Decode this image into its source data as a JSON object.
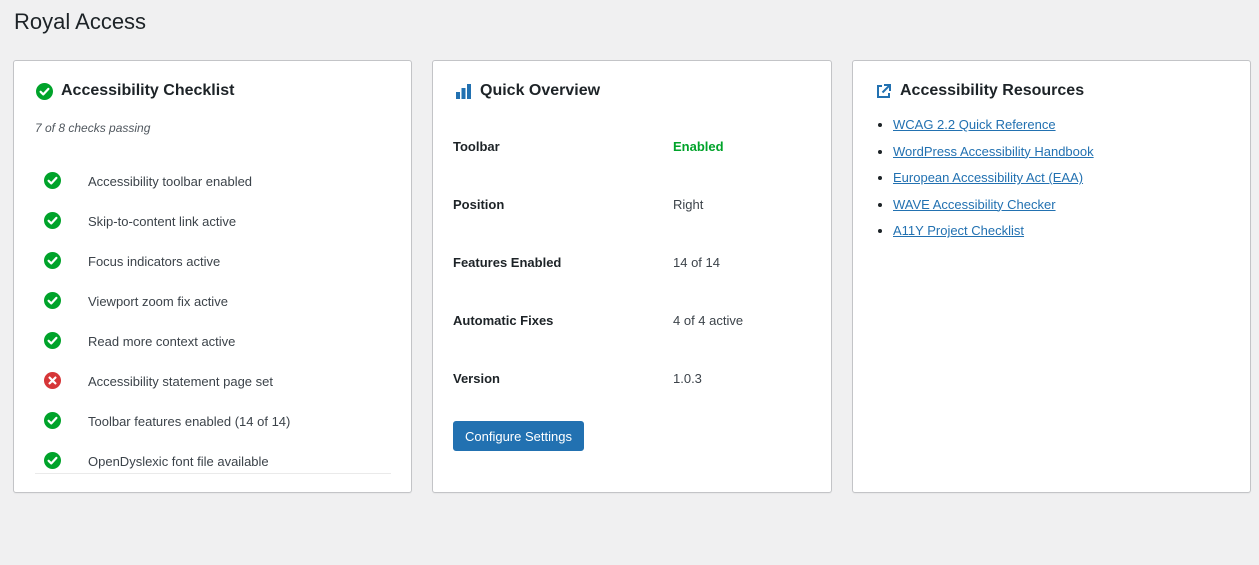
{
  "page": {
    "title": "Royal Access"
  },
  "colors": {
    "accent": "#2271b1",
    "success": "#00a32a",
    "error": "#d63638"
  },
  "checklist": {
    "title": "Accessibility Checklist",
    "header_icon": "check-circle-icon",
    "summary": "7 of 8 checks passing",
    "items": [
      {
        "label": "Accessibility toolbar enabled",
        "status": "pass"
      },
      {
        "label": "Skip-to-content link active",
        "status": "pass"
      },
      {
        "label": "Focus indicators active",
        "status": "pass"
      },
      {
        "label": "Viewport zoom fix active",
        "status": "pass"
      },
      {
        "label": "Read more context active",
        "status": "pass"
      },
      {
        "label": "Accessibility statement page set",
        "status": "fail"
      },
      {
        "label": "Toolbar features enabled (14 of 14)",
        "status": "pass"
      },
      {
        "label": "OpenDyslexic font file available",
        "status": "pass"
      }
    ]
  },
  "overview": {
    "title": "Quick Overview",
    "header_icon": "bar-chart-icon",
    "rows": [
      {
        "key": "Toolbar",
        "value": "Enabled"
      },
      {
        "key": "Position",
        "value": "Right"
      },
      {
        "key": "Features Enabled",
        "value": "14 of 14"
      },
      {
        "key": "Automatic Fixes",
        "value": "4 of 4 active"
      },
      {
        "key": "Version",
        "value": "1.0.3"
      }
    ],
    "button_label": "Configure Settings"
  },
  "resources": {
    "title": "Accessibility Resources",
    "header_icon": "external-link-icon",
    "links": [
      "WCAG 2.2 Quick Reference",
      "WordPress Accessibility Handbook",
      "European Accessibility Act (EAA)",
      "WAVE Accessibility Checker",
      "A11Y Project Checklist"
    ]
  }
}
